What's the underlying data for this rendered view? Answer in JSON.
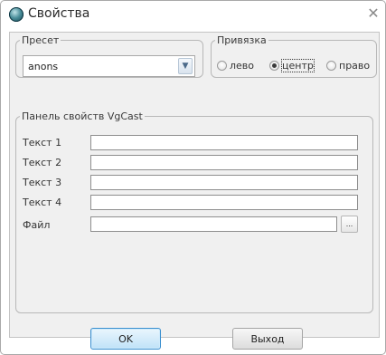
{
  "window": {
    "title": "Свойства",
    "close_label": "✕"
  },
  "preset": {
    "group_label": "Пресет",
    "selected": "anons",
    "arrow_icon": "dropdown-arrow-icon"
  },
  "anchor": {
    "group_label": "Привязка",
    "options": [
      {
        "label": "лево",
        "checked": false
      },
      {
        "label": "центр",
        "checked": true
      },
      {
        "label": "право",
        "checked": false
      }
    ]
  },
  "props": {
    "group_label": "Панель свойств VgCast",
    "fields": [
      {
        "label": "Текст 1",
        "value": ""
      },
      {
        "label": "Текст 2",
        "value": ""
      },
      {
        "label": "Текст 3",
        "value": ""
      },
      {
        "label": "Текст 4",
        "value": ""
      }
    ],
    "file": {
      "label": "Файл",
      "value": "",
      "browse_label": "..."
    }
  },
  "buttons": {
    "ok": "OK",
    "exit": "Выход"
  }
}
